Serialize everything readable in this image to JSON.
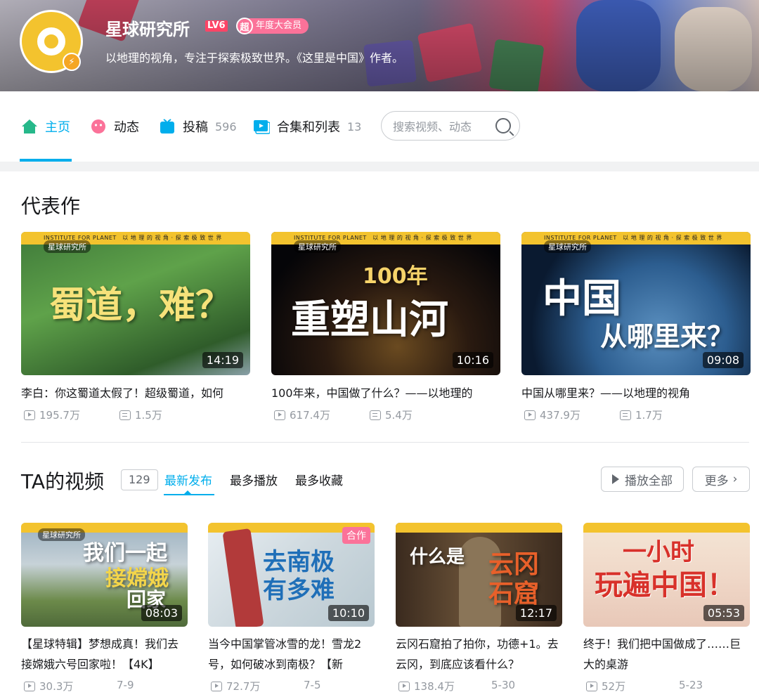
{
  "profile": {
    "name": "星球研究所",
    "level": "LV6",
    "vip_mark": "超",
    "vip_label": "年度大会员",
    "sign": "以地理的视角，专注于探索极致世界。《这里是中国》作者。"
  },
  "nav": {
    "home": "主页",
    "dynamic": "动态",
    "posts": "投稿",
    "posts_count": "596",
    "collections": "合集和列表",
    "collections_count": "13",
    "search_placeholder": "搜索视频、动态"
  },
  "featured": {
    "title": "代表作",
    "videos": [
      {
        "brand": "星球研究所",
        "strip": "INSTITUTE FOR PLANET　以 地 理 的 视 角 · 探 索 极 致 世 界",
        "overlay": "蜀道，难？",
        "duration": "14:19",
        "title": "李白：你这蜀道太假了！超级蜀道，如何",
        "plays": "195.7万",
        "danmaku": "1.5万"
      },
      {
        "brand": "星球研究所",
        "strip": "INSTITUTE FOR PLANET　以 地 理 的 视 角 · 探 索 极 致 世 界",
        "overlay_top": "100年",
        "overlay": "重塑山河",
        "duration": "10:16",
        "title": "100年来，中国做了什么？——以地理的",
        "plays": "617.4万",
        "danmaku": "5.4万"
      },
      {
        "brand": "星球研究所",
        "strip": "INSTITUTE FOR PLANET　以 地 理 的 视 角 · 探 索 极 致 世 界",
        "overlay": "中国",
        "overlay_bottom": "从哪里来？",
        "duration": "09:08",
        "title": "中国从哪里来？——以地理的视角",
        "plays": "437.9万",
        "danmaku": "1.7万"
      }
    ]
  },
  "videos_section": {
    "title": "TA的视频",
    "count": "129",
    "tabs": [
      "最新发布",
      "最多播放",
      "最多收藏"
    ],
    "play_all": "播放全部",
    "more": "更多",
    "videos": [
      {
        "brand": "星球研究所",
        "overlay": "我们一起",
        "overlay2": "接嫦娥",
        "overlay3": "回家",
        "duration": "08:03",
        "badge": "",
        "title": "【星球特辑】梦想成真！我们去接嫦娥六号回家啦！【4K】",
        "plays": "30.3万",
        "date": "7-9"
      },
      {
        "brand": "",
        "overlay": "去南极",
        "overlay2": "有多难",
        "overlay3": "",
        "duration": "10:10",
        "badge": "合作",
        "title": "当今中国掌管冰雪的龙！雪龙2号，如何破冰到南极？【新",
        "plays": "72.7万",
        "date": "7-5"
      },
      {
        "brand": "",
        "overlay": "什么是",
        "overlay2": "云冈",
        "overlay3": "石窟",
        "duration": "12:17",
        "badge": "",
        "title": "云冈石窟拍了拍你，功德+1。去云冈，到底应该看什么？",
        "plays": "138.4万",
        "date": "5-30"
      },
      {
        "brand": "",
        "overlay": "一小时",
        "overlay2": "玩遍中国！",
        "overlay3": "",
        "duration": "05:53",
        "badge": "",
        "title": "终于！我们把中国做成了……巨大的桌游",
        "plays": "52万",
        "date": "5-23"
      }
    ]
  }
}
